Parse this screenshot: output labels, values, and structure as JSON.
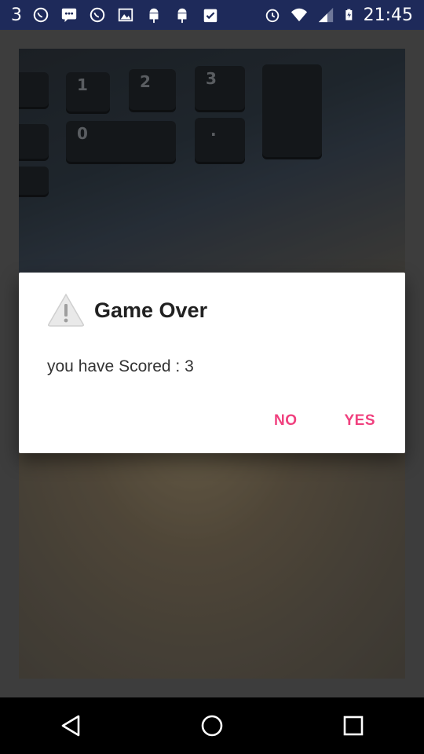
{
  "status_bar": {
    "notification_count": "3",
    "notification_icons": [
      "whatsapp-icon",
      "message-icon",
      "whatsapp-icon",
      "image-icon",
      "android-icon",
      "android-icon",
      "clipboard-check-icon"
    ],
    "status_icons": [
      "alarm-icon",
      "wifi-icon",
      "signal-icon",
      "battery-charging-icon"
    ],
    "time": "21:45"
  },
  "dialog": {
    "icon": "warning-icon",
    "title": "Game Over",
    "message": "you have Scored : 3",
    "buttons": {
      "no": "NO",
      "yes": "YES"
    },
    "accent_color": "#f0407e"
  },
  "background": {
    "keyboard_keys": [
      "1",
      "2",
      "3",
      "0",
      "."
    ]
  },
  "nav_bar": {
    "buttons": [
      "back-icon",
      "home-icon",
      "recents-icon"
    ]
  }
}
